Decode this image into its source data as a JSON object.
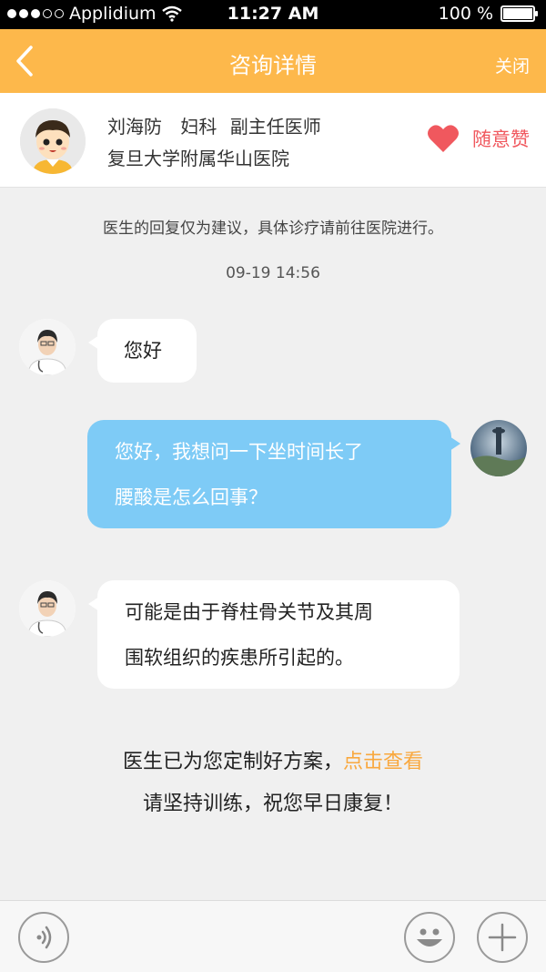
{
  "status_bar": {
    "carrier": "Applidium",
    "time": "11:27 AM",
    "battery": "100 %",
    "battery_level": 1.0
  },
  "nav": {
    "title": "咨询详情",
    "close_label": "关闭"
  },
  "doctor": {
    "name": "刘海防",
    "department": "妇科",
    "title": "副主任医师",
    "hospital": "复旦大学附属华山医院",
    "like_label": "随意赞"
  },
  "notice": "医生的回复仅为建议，具体诊疗请前往医院进行。",
  "timestamp": "09-19 14:56",
  "messages": [
    {
      "side": "left",
      "lines": [
        "您好"
      ]
    },
    {
      "side": "right",
      "lines": [
        "您好，我想问一下坐时间长了",
        "腰酸是怎么回事？"
      ]
    },
    {
      "side": "left",
      "lines": [
        "可能是由于脊柱骨关节及其周",
        "围软组织的疾患所引起的。"
      ]
    }
  ],
  "plan": {
    "text": "医生已为您定制好方案，",
    "link": "点击查看",
    "line2": "请坚持训练，祝您早日康复！"
  },
  "colors": {
    "nav_bg": "#fdb84b",
    "bubble_right": "#7ecbf6",
    "like": "#f0585e",
    "link": "#f9a83e"
  }
}
